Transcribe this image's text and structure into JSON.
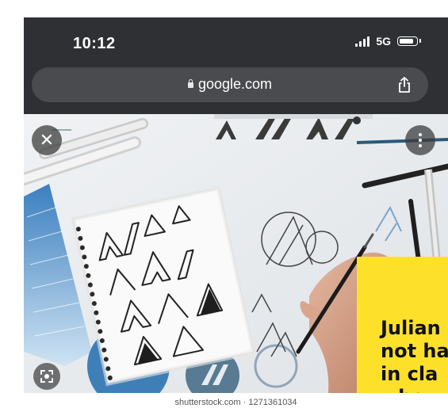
{
  "status_bar": {
    "time": "10:12",
    "network": "5G",
    "icons": [
      "signal-icon",
      "battery-icon"
    ]
  },
  "browser": {
    "url": "google.com",
    "icons": [
      "lock-icon",
      "share-icon"
    ]
  },
  "viewer": {
    "icons": [
      "close-icon",
      "more-vert-icon",
      "lens-icon"
    ],
    "ad_lines": [
      "Julian",
      "not ha",
      "in cla",
      "whe"
    ],
    "caption": "shutterstock.com · 1271361034"
  },
  "colors": {
    "chrome_dark": "#2f3033",
    "url_pill": "#4a4b4f",
    "ad_yellow": "#fde02a"
  }
}
